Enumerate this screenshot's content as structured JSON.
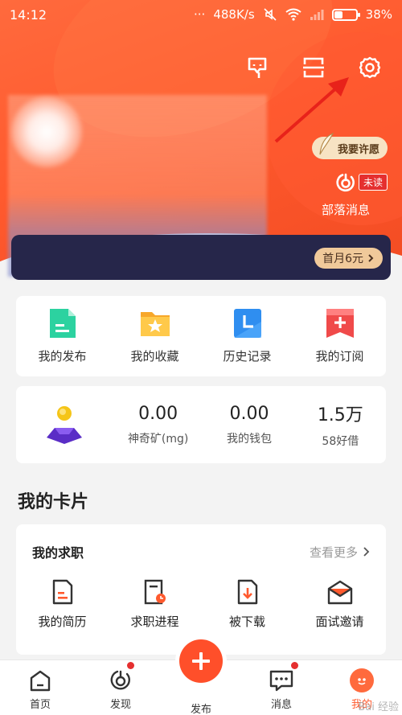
{
  "status_bar": {
    "time": "14:12",
    "dots": "···",
    "speed": "488K/s",
    "battery_percent": "38%",
    "battery_level": 0.38
  },
  "header": {
    "wish_button": "我要许愿",
    "tribe": {
      "label": "部落消息",
      "badge": "未读"
    },
    "vip_button": "首月6元"
  },
  "quick_actions": [
    {
      "label": "我的发布",
      "icon": "publish-doc-icon"
    },
    {
      "label": "我的收藏",
      "icon": "favorites-folder-icon"
    },
    {
      "label": "历史记录",
      "icon": "history-clock-icon"
    },
    {
      "label": "我的订阅",
      "icon": "subscribe-plus-icon"
    }
  ],
  "stats": [
    {
      "value": "0.00",
      "label": "神奇矿(mg)"
    },
    {
      "value": "0.00",
      "label": "我的钱包"
    },
    {
      "value": "1.5万",
      "label": "58好借"
    }
  ],
  "section_title": "我的卡片",
  "job_card": {
    "title": "我的求职",
    "more": "查看更多",
    "items": [
      {
        "label": "我的简历",
        "icon": "resume-icon"
      },
      {
        "label": "求职进程",
        "icon": "progress-icon"
      },
      {
        "label": "被下载",
        "icon": "download-icon"
      },
      {
        "label": "面试邀请",
        "icon": "invite-envelope-icon"
      }
    ]
  },
  "bottom_nav": [
    {
      "label": "首页",
      "icon": "home-icon"
    },
    {
      "label": "发现",
      "icon": "discover-icon"
    },
    {
      "label": "发布",
      "icon": "plus-icon"
    },
    {
      "label": "消息",
      "icon": "message-icon"
    },
    {
      "label": "我的",
      "icon": "profile-icon"
    }
  ],
  "watermark": "Bai 经验",
  "colors": {
    "brand": "#ff5a2e",
    "badge": "#e52f2f",
    "vip_bar": "#26264a",
    "vip_button": "#f0c99a"
  }
}
